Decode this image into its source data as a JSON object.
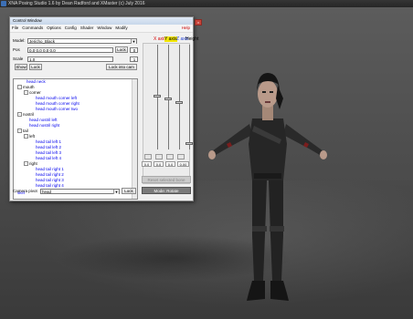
{
  "app": {
    "title": "XNA Posing Studio 1.6 by Dean Radford and XMaster (c) July 2016"
  },
  "control_window": {
    "title": "Control Window",
    "menu": [
      "File",
      "Commands",
      "Options",
      "Config",
      "Shader",
      "Window",
      "Modify"
    ],
    "help_label": "Help",
    "model_label": "Model:",
    "model_value": "Jericho_Black",
    "pos_label": "Pos",
    "pos_value": "0.0 0.0 0.0 0.0",
    "lock_label": "Lock",
    "pos_number": "0",
    "scale_label": "Scale",
    "scale_value": "1.0",
    "scale_number": "1",
    "show_label": "Show",
    "lock2_label": "Lock",
    "lock_into_cam_label": "Lock into cam",
    "tree": [
      {
        "text": "head neck",
        "type": "leaf"
      },
      {
        "text": "mouth",
        "type": "group"
      },
      {
        "text": "corner",
        "type": "group"
      },
      {
        "text": "head mouth corner left",
        "type": "leaf"
      },
      {
        "text": "head mouth corner right",
        "type": "leaf"
      },
      {
        "text": "head mouth corner two",
        "type": "leaf"
      },
      {
        "text": "nostril",
        "type": "group"
      },
      {
        "text": "head nostril left",
        "type": "leaf"
      },
      {
        "text": "head nostril right",
        "type": "leaf"
      },
      {
        "text": "tail",
        "type": "group"
      },
      {
        "text": "left",
        "type": "group"
      },
      {
        "text": "head tail left 1",
        "type": "leaf"
      },
      {
        "text": "head tail left 2",
        "type": "leaf"
      },
      {
        "text": "head tail left 3",
        "type": "leaf"
      },
      {
        "text": "head tail left 4",
        "type": "leaf"
      },
      {
        "text": "right",
        "type": "group"
      },
      {
        "text": "head tail right 1",
        "type": "leaf"
      },
      {
        "text": "head tail right 2",
        "type": "leaf"
      },
      {
        "text": "head tail right 3",
        "type": "leaf"
      },
      {
        "text": "head tail right 4",
        "type": "leaf"
      },
      {
        "text": "skirt",
        "type": "leaf"
      }
    ],
    "axes": [
      {
        "label": "X axis",
        "color": "#d40000",
        "bg": "",
        "value": "0.0"
      },
      {
        "label": "Y axis",
        "color": "#000000",
        "bg": "#f2e600",
        "value": "0.0"
      },
      {
        "label": "Z axis",
        "color": "#1a3bd6",
        "bg": "",
        "value": "0.0"
      },
      {
        "label": "Height",
        "color": "#000000",
        "bg": "",
        "value": "0.00"
      }
    ],
    "reset_label": "Reset selected bone",
    "camera_pivot_label": "Camera pivot",
    "camera_pivot_value": "head",
    "camera_lock_label": "Lock",
    "mode_label": "Mode: Rotate"
  }
}
